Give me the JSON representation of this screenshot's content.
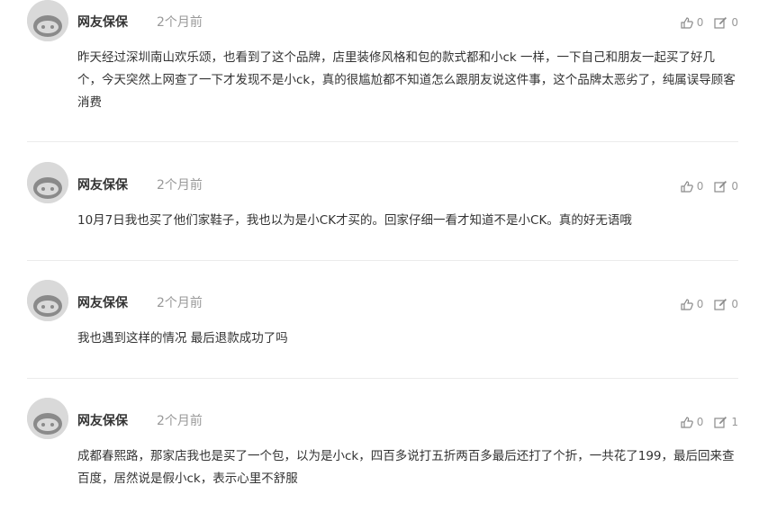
{
  "comments": [
    {
      "author": "网友保保",
      "time": "2个月前",
      "likes": "0",
      "replies": "0",
      "text": "昨天经过深圳南山欢乐颂，也看到了这个品牌，店里装修风格和包的款式都和小ck 一样，一下自己和朋友一起买了好几个，今天突然上网查了一下才发现不是小ck，真的很尴尬都不知道怎么跟朋友说这件事，这个品牌太恶劣了，纯属误导顾客消费"
    },
    {
      "author": "网友保保",
      "time": "2个月前",
      "likes": "0",
      "replies": "0",
      "text": "10月7日我也买了他们家鞋子，我也以为是小CK才买的。回家仔细一看才知道不是小CK。真的好无语哦"
    },
    {
      "author": "网友保保",
      "time": "2个月前",
      "likes": "0",
      "replies": "0",
      "text": "我也遇到这样的情况 最后退款成功了吗"
    },
    {
      "author": "网友保保",
      "time": "2个月前",
      "likes": "0",
      "replies": "1",
      "text": "成都春熙路，那家店我也是买了一个包，以为是小ck，四百多说打五折两百多最后还打了个折，一共花了199，最后回来查百度，居然说是假小ck，表示心里不舒服"
    }
  ],
  "icons": {
    "like": "thumbs-up-icon",
    "reply": "edit-reply-icon",
    "avatar": "default-avatar-icon"
  },
  "colors": {
    "text": "#333333",
    "muted": "#999999",
    "divider": "#ebebeb",
    "avatar_bg": "#d9d9d9"
  }
}
